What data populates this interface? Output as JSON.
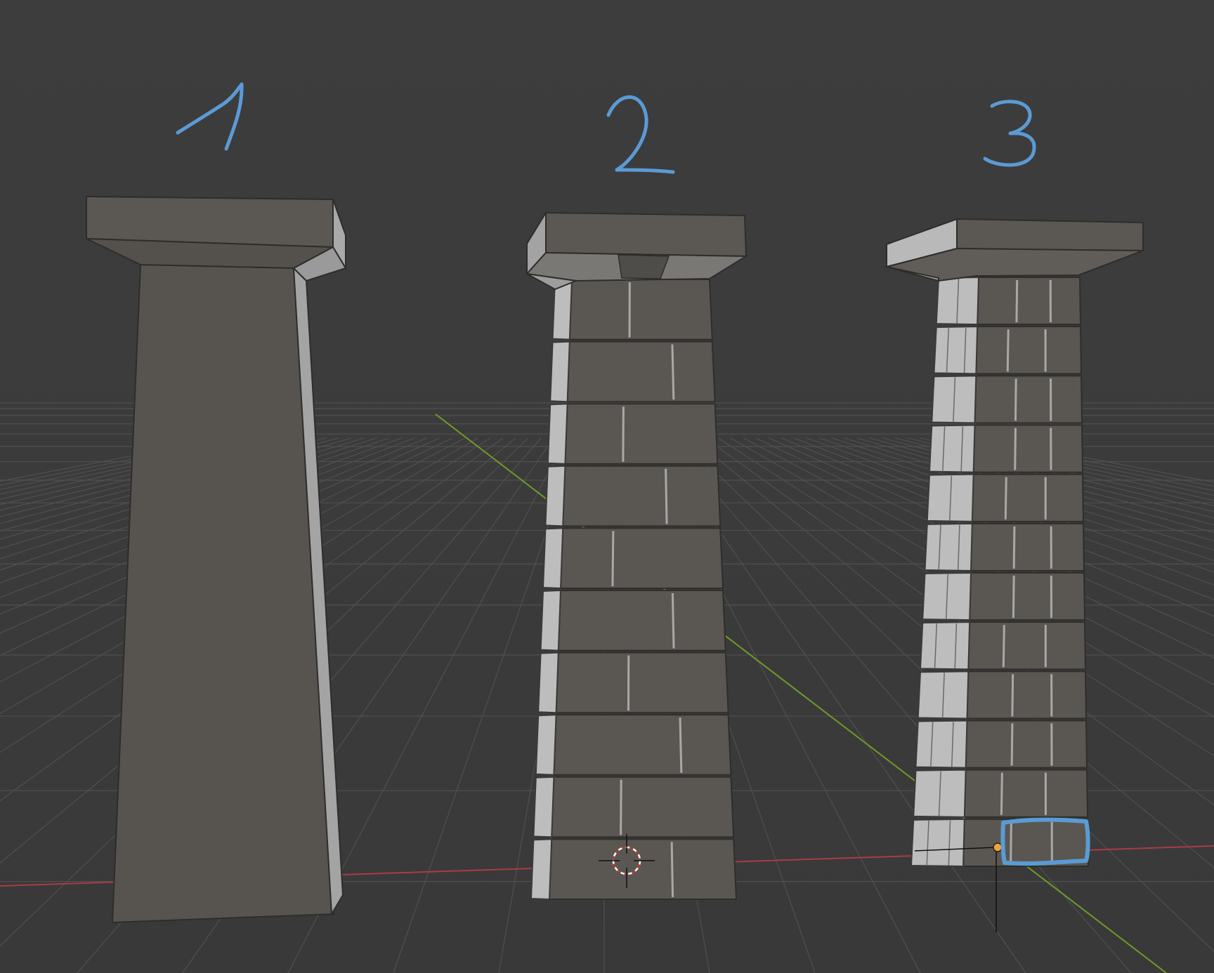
{
  "viewport": {
    "background": "#3b3b3b",
    "grid_color": "#555555",
    "x_axis_color": "#b0404b",
    "y_axis_color": "#6f9a2a",
    "annotation_color": "#5a9bd4"
  },
  "annotations": [
    {
      "text": "1"
    },
    {
      "text": "2"
    },
    {
      "text": "3"
    }
  ],
  "objects": [
    {
      "name": "pillar-plain",
      "style": "untextured tapered pillar with slab top"
    },
    {
      "name": "pillar-bricks-large",
      "style": "tapered pillar with large brick courses"
    },
    {
      "name": "pillar-bricks-small",
      "style": "tapered pillar with small brick courses, highlighted bottom brick"
    }
  ],
  "gizmos": {
    "cursor": "3d-cursor-icon",
    "origin": "object-origin-dot",
    "highlight": "selection-highlight"
  }
}
